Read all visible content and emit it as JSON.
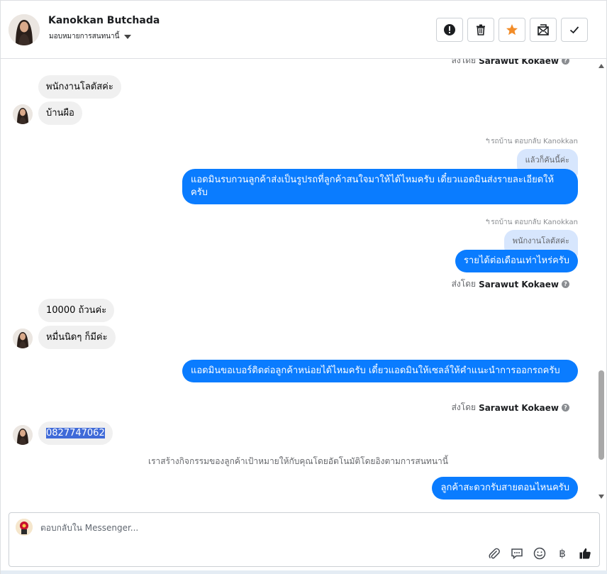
{
  "header": {
    "contact_name": "Kanokkan Butchada",
    "assign_label": "มอบหมายการสนทนานี้",
    "actions": [
      "spam-icon",
      "trash-icon",
      "star-icon",
      "mark-unread-icon",
      "done-icon"
    ],
    "star_color": "#f28c28"
  },
  "messages": {
    "top_sent_by": {
      "prefix": "ส่งโดย",
      "name": "Sarawut Kokaew"
    },
    "incoming_1": [
      "พนักงานโลตัสค่ะ",
      "บ้านผือ"
    ],
    "reply_1": {
      "label": "รถบ้าน ตอบกลับ Kanokkan",
      "quote": "แล้วก็คันนี้ค่ะ",
      "text": "แอดมินรบกวนลูกค้าส่งเป็นรูปรถที่ลูกค้าสนใจมาให้ได้ไหมครับ เดี๋ยวแอดมินส่งรายละเอียดให้ครับ"
    },
    "reply_2": {
      "label": "รถบ้าน ตอบกลับ Kanokkan",
      "quote": "พนักงานโลตัสค่ะ",
      "text": "รายได้ต่อเดือนเท่าไหร่ครับ"
    },
    "sent_by_1": {
      "prefix": "ส่งโดย",
      "name": "Sarawut Kokaew"
    },
    "incoming_2": [
      "10000 ถ้วนค่ะ",
      "หมื่นนิดๆ ก็มีค่ะ"
    ],
    "outgoing_3": "แอดมินขอเบอร์ติดต่อลูกค้าหน่อยได้ไหมครับ เดี๋ยวแอดมินให้เซลล์ให้คำแนะนำการออกรถครับ",
    "sent_by_2": {
      "prefix": "ส่งโดย",
      "name": "Sarawut Kokaew"
    },
    "incoming_3": "0827747062",
    "system_note": "เราสร้างกิจกรรมของลูกค้าเป้าหมายให้กับคุณโดยอัตโนมัติโดยอิงตามการสนทนานี้",
    "outgoing_4": "ลูกค้าสะดวกรับสายตอนไหนครับ"
  },
  "composer": {
    "placeholder": "ตอบกลับใน Messenger...",
    "tools": [
      "attachment-icon",
      "saved-replies-icon",
      "emoji-icon",
      "payment-icon",
      "like-icon"
    ],
    "payment_symbol": "฿"
  },
  "colors": {
    "outgoing_bubble": "#0a7cff",
    "incoming_bubble": "#f0f0f0",
    "quote_bubble": "#d7e6fd"
  }
}
